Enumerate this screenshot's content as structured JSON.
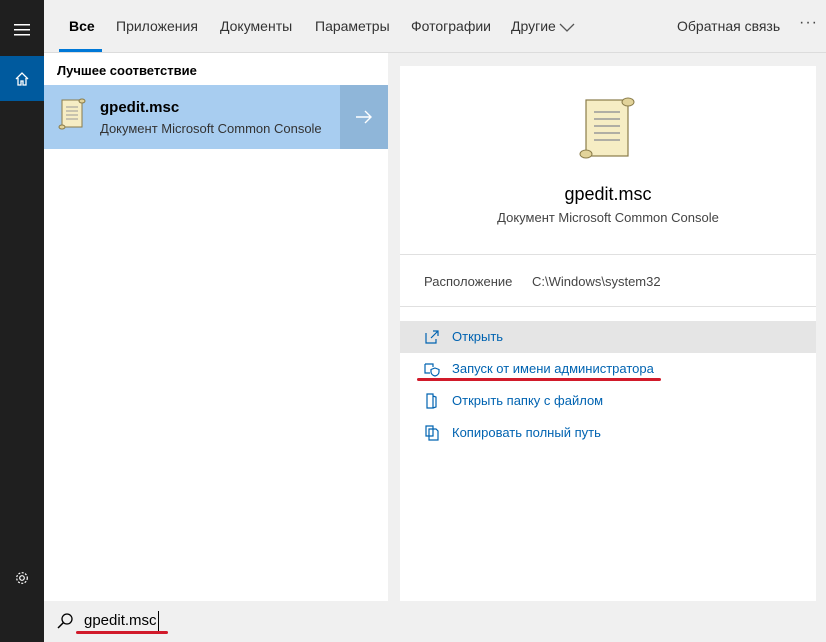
{
  "rail": {
    "menu_icon": "hamburger-icon",
    "home_icon": "home-icon",
    "settings_icon": "gear-icon"
  },
  "tabs": {
    "items": [
      "Все",
      "Приложения",
      "Документы",
      "Параметры",
      "Фотографии",
      "Другие"
    ],
    "active": "Все",
    "feedback": "Обратная связь",
    "more": "···"
  },
  "results": {
    "section_title": "Лучшее соответствие",
    "best_match": {
      "name": "gpedit.msc",
      "subtitle": "Документ Microsoft Common Console"
    }
  },
  "preview": {
    "name": "gpedit.msc",
    "subtitle": "Документ Microsoft Common Console",
    "location_label": "Расположение",
    "location_value": "C:\\Windows\\system32",
    "actions": [
      {
        "label": "Открыть",
        "icon": "open-icon"
      },
      {
        "label": "Запуск от имени администратора",
        "icon": "shield-icon"
      },
      {
        "label": "Открыть папку с файлом",
        "icon": "folder-icon"
      },
      {
        "label": "Копировать полный путь",
        "icon": "copy-icon"
      }
    ]
  },
  "search": {
    "value": "gpedit.msc"
  },
  "colors": {
    "accent": "#0078d7",
    "selection": "#a8cdf0",
    "link": "#0063b1",
    "annotation": "#d11a2a"
  }
}
